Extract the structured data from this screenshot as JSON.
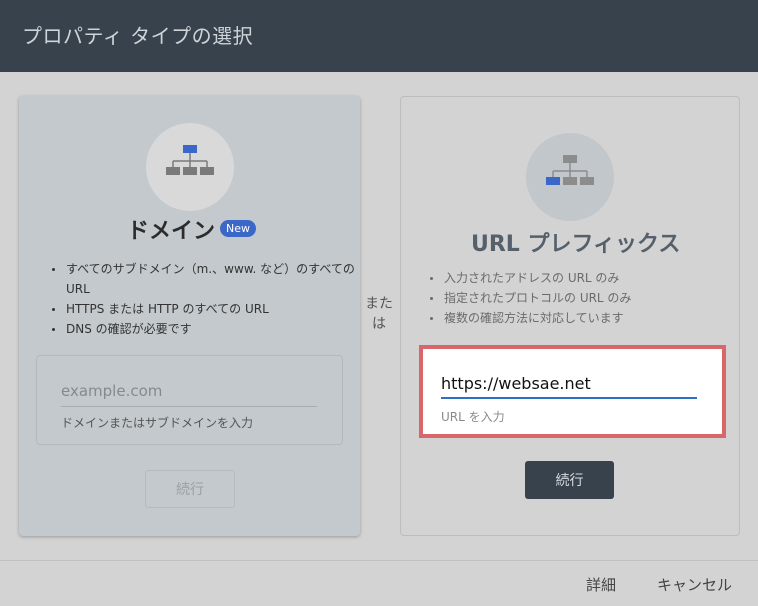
{
  "dialog": {
    "title": "プロパティ タイプの選択"
  },
  "domain_card": {
    "title": "ドメイン",
    "badge": "New",
    "bullets": [
      "すべてのサブドメイン（m.、www. など）のすべての URL",
      "HTTPS または HTTP のすべての URL",
      "DNS の確認が必要です"
    ],
    "input_placeholder": "example.com",
    "input_helper": "ドメインまたはサブドメインを入力",
    "continue_label": "続行"
  },
  "separator": {
    "line1": "また",
    "line2": "は"
  },
  "url_card": {
    "title": "URL プレフィックス",
    "bullets": [
      "入力されたアドレスの URL のみ",
      "指定されたプロトコルの URL のみ",
      "複数の確認方法に対応しています"
    ],
    "input_value": "https://websae.net",
    "input_helper": "URL を入力",
    "continue_label": "続行"
  },
  "footer": {
    "details_label": "詳細",
    "cancel_label": "キャンセル"
  },
  "colors": {
    "header_bg": "#37424c",
    "accent_blue": "#3a67c8",
    "highlight_border": "#d9666b",
    "button_dark": "#37424c"
  },
  "icons": {
    "domain_icon": "sitemap-icon",
    "url_icon": "sitemap-icon"
  }
}
